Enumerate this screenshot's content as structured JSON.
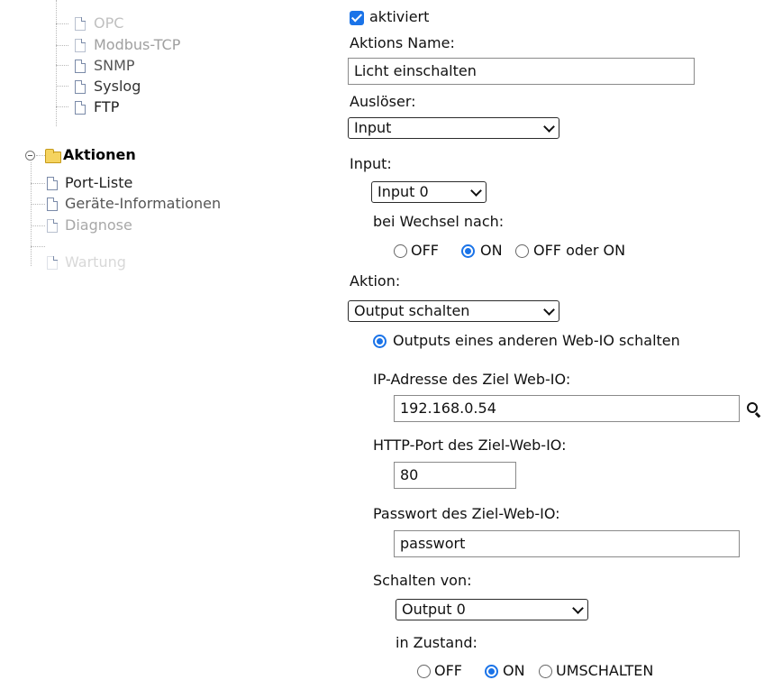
{
  "tree": {
    "items": [
      {
        "label": "OPC"
      },
      {
        "label": "Modbus-TCP"
      },
      {
        "label": "SNMP"
      },
      {
        "label": "Syslog"
      },
      {
        "label": "FTP"
      },
      {
        "label": "Aktionen"
      },
      {
        "label": "Port-Liste"
      },
      {
        "label": "Geräte-Informationen"
      },
      {
        "label": "Diagnose"
      },
      {
        "label": "Wartung"
      }
    ]
  },
  "form": {
    "aktiviert_label": "aktiviert",
    "aktiviert_checked": true,
    "name_label": "Aktions Name:",
    "name_value": "Licht einschalten",
    "trigger_label": "Auslöser:",
    "trigger_value": "Input",
    "input_label": "Input:",
    "input_value": "Input 0",
    "change_label": "bei Wechsel nach:",
    "change_options": [
      "OFF",
      "ON",
      "OFF oder ON"
    ],
    "change_selected": "ON",
    "action_label": "Aktion:",
    "action_value": "Output schalten",
    "remote_option_label": "Outputs eines anderen Web-IO schalten",
    "ip_label": "IP-Adresse des Ziel Web-IO:",
    "ip_value": "192.168.0.54",
    "port_label": "HTTP-Port des Ziel-Web-IO:",
    "port_value": "80",
    "password_label": "Passwort des Ziel-Web-IO:",
    "password_value": "passwort",
    "switch_label": "Schalten von:",
    "switch_value": "Output 0",
    "state_label": "in Zustand:",
    "state_options": [
      "OFF",
      "ON",
      "UMSCHALTEN"
    ],
    "state_selected": "ON"
  }
}
